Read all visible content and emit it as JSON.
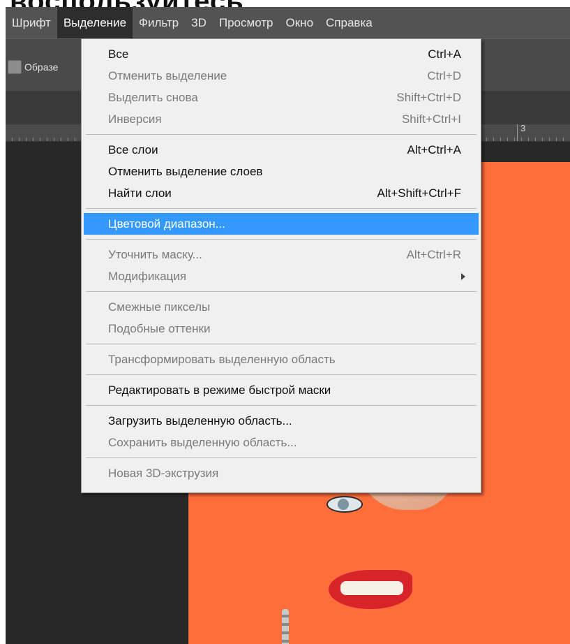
{
  "caption": {
    "text": "воспользуйтесь"
  },
  "menubar": {
    "items": [
      {
        "label": "Шрифт",
        "active": false
      },
      {
        "label": "Выделение",
        "active": true
      },
      {
        "label": "Фильтр",
        "active": false
      },
      {
        "label": "3D",
        "active": false
      },
      {
        "label": "Просмотр",
        "active": false
      },
      {
        "label": "Окно",
        "active": false
      },
      {
        "label": "Справка",
        "active": false
      }
    ]
  },
  "options": {
    "checkbox_label": "Образе"
  },
  "ruler": {
    "number": "3"
  },
  "dropdown": {
    "sections": [
      [
        {
          "label": "Все",
          "shortcut": "Ctrl+A",
          "enabled": true
        },
        {
          "label": "Отменить выделение",
          "shortcut": "Ctrl+D",
          "enabled": false
        },
        {
          "label": "Выделить снова",
          "shortcut": "Shift+Ctrl+D",
          "enabled": false
        },
        {
          "label": "Инверсия",
          "shortcut": "Shift+Ctrl+I",
          "enabled": false
        }
      ],
      [
        {
          "label": "Все слои",
          "shortcut": "Alt+Ctrl+A",
          "enabled": true
        },
        {
          "label": "Отменить выделение слоев",
          "shortcut": "",
          "enabled": true
        },
        {
          "label": "Найти слои",
          "shortcut": "Alt+Shift+Ctrl+F",
          "enabled": true
        }
      ],
      [
        {
          "label": "Цветовой диапазон...",
          "shortcut": "",
          "enabled": true,
          "highlighted": true
        }
      ],
      [
        {
          "label": "Уточнить маску...",
          "shortcut": "Alt+Ctrl+R",
          "enabled": false
        },
        {
          "label": "Модификация",
          "shortcut": "",
          "enabled": false,
          "submenu": true
        }
      ],
      [
        {
          "label": "Смежные пикселы",
          "shortcut": "",
          "enabled": false
        },
        {
          "label": "Подобные оттенки",
          "shortcut": "",
          "enabled": false
        }
      ],
      [
        {
          "label": "Трансформировать выделенную область",
          "shortcut": "",
          "enabled": false
        }
      ],
      [
        {
          "label": "Редактировать в режиме быстрой маски",
          "shortcut": "",
          "enabled": true
        }
      ],
      [
        {
          "label": "Загрузить выделенную область...",
          "shortcut": "",
          "enabled": true
        },
        {
          "label": "Сохранить выделенную область...",
          "shortcut": "",
          "enabled": false
        }
      ],
      [
        {
          "label": "Новая 3D-экструзия",
          "shortcut": "",
          "enabled": false
        }
      ]
    ]
  },
  "colors": {
    "menubar_bg": "#535353",
    "menu_bg": "#f0f0f0",
    "highlight": "#3399ff",
    "canvas_orange": "#ff6d3b"
  }
}
